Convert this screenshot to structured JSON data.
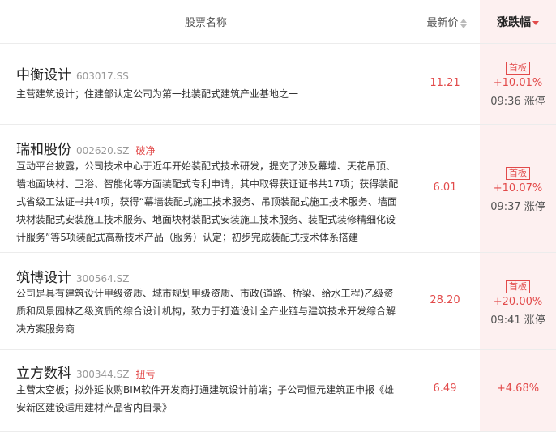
{
  "header": {
    "name_label": "股票名称",
    "price_label": "最新价",
    "change_label": "涨跌幅"
  },
  "rows": [
    {
      "name": "中衡设计",
      "code": "603017.SS",
      "tag": "",
      "description": "主营建筑设计；住建部认定公司为第一批装配式建筑产业基地之一",
      "price": "11.21",
      "badge": "首板",
      "change": "+10.01%",
      "limit_time": "09:36 涨停"
    },
    {
      "name": "瑞和股份",
      "code": "002620.SZ",
      "tag": "破净",
      "description": "互动平台披露，公司技术中心于近年开始装配式技术研发，提交了涉及幕墙、天花吊顶、墙地面块材、卫浴、智能化等方面装配式专利申请，其中取得获证证书共17项；获得装配式省级工法证书共4项，获得“幕墙装配式施工技术服务、吊顶装配式施工技术服务、墙面块材装配式安装施工技术服务、地面块材装配式安装施工技术服务、装配式装修精细化设计服务”等5项装配式高新技术产品（服务）认定；初步完成装配式技术体系搭建",
      "price": "6.01",
      "badge": "首板",
      "change": "+10.07%",
      "limit_time": "09:37 涨停"
    },
    {
      "name": "筑博设计",
      "code": "300564.SZ",
      "tag": "",
      "description": "公司是具有建筑设计甲级资质、城市规划甲级资质、市政(道路、桥梁、给水工程)乙级资质和风景园林乙级资质的综合设计机构，致力于打造设计全产业链与建筑技术开发综合解决方案服务商",
      "price": "28.20",
      "badge": "首板",
      "change": "+20.00%",
      "limit_time": "09:41 涨停"
    },
    {
      "name": "立方数科",
      "code": "300344.SZ",
      "tag": "扭亏",
      "description": "主营太空板；拟外延收购BIM软件开发商打通建筑设计前端；子公司恒元建筑正申报《雄安新区建设适用建材产品省内目录》",
      "price": "6.49",
      "badge": "",
      "change": "+4.68%",
      "limit_time": ""
    }
  ],
  "colors": {
    "up": "#e24a4a",
    "sorted_column_bg": "#fdf0f0"
  }
}
